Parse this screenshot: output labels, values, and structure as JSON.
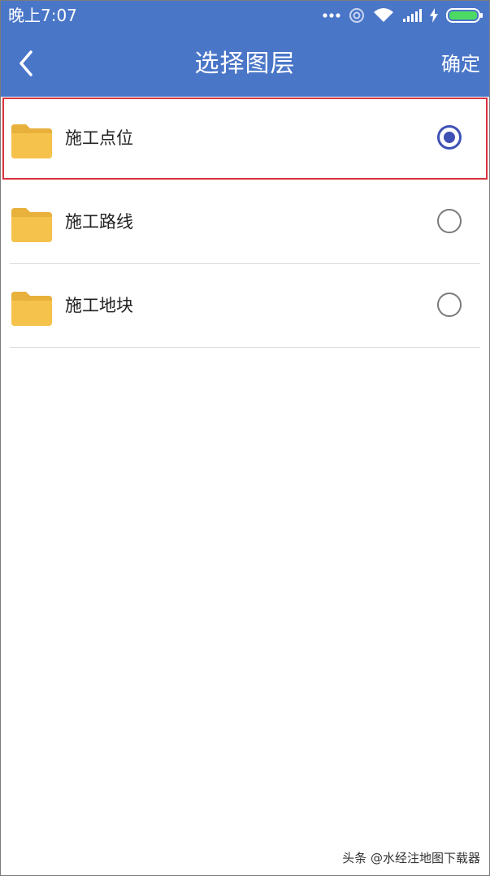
{
  "status_bar": {
    "time": "晚上7:07",
    "icons": [
      "more-dots-icon",
      "sync-icon",
      "wifi-icon",
      "signal-icon",
      "charging-icon",
      "battery-icon"
    ],
    "colors": {
      "background": "#4a76c8",
      "battery": "#4cd964"
    }
  },
  "nav_bar": {
    "back_icon": "chevron-left-icon",
    "title": "选择图层",
    "confirm_label": "确定"
  },
  "layers": [
    {
      "label": "施工点位",
      "icon": "folder-icon",
      "selected": true
    },
    {
      "label": "施工路线",
      "icon": "folder-icon",
      "selected": false
    },
    {
      "label": "施工地块",
      "icon": "folder-icon",
      "selected": false
    }
  ],
  "watermark": "头条 @水经注地图下载器",
  "colors": {
    "accent": "#3f51b5",
    "folder": "#f5c24b",
    "highlight_border": "#d9333f"
  }
}
